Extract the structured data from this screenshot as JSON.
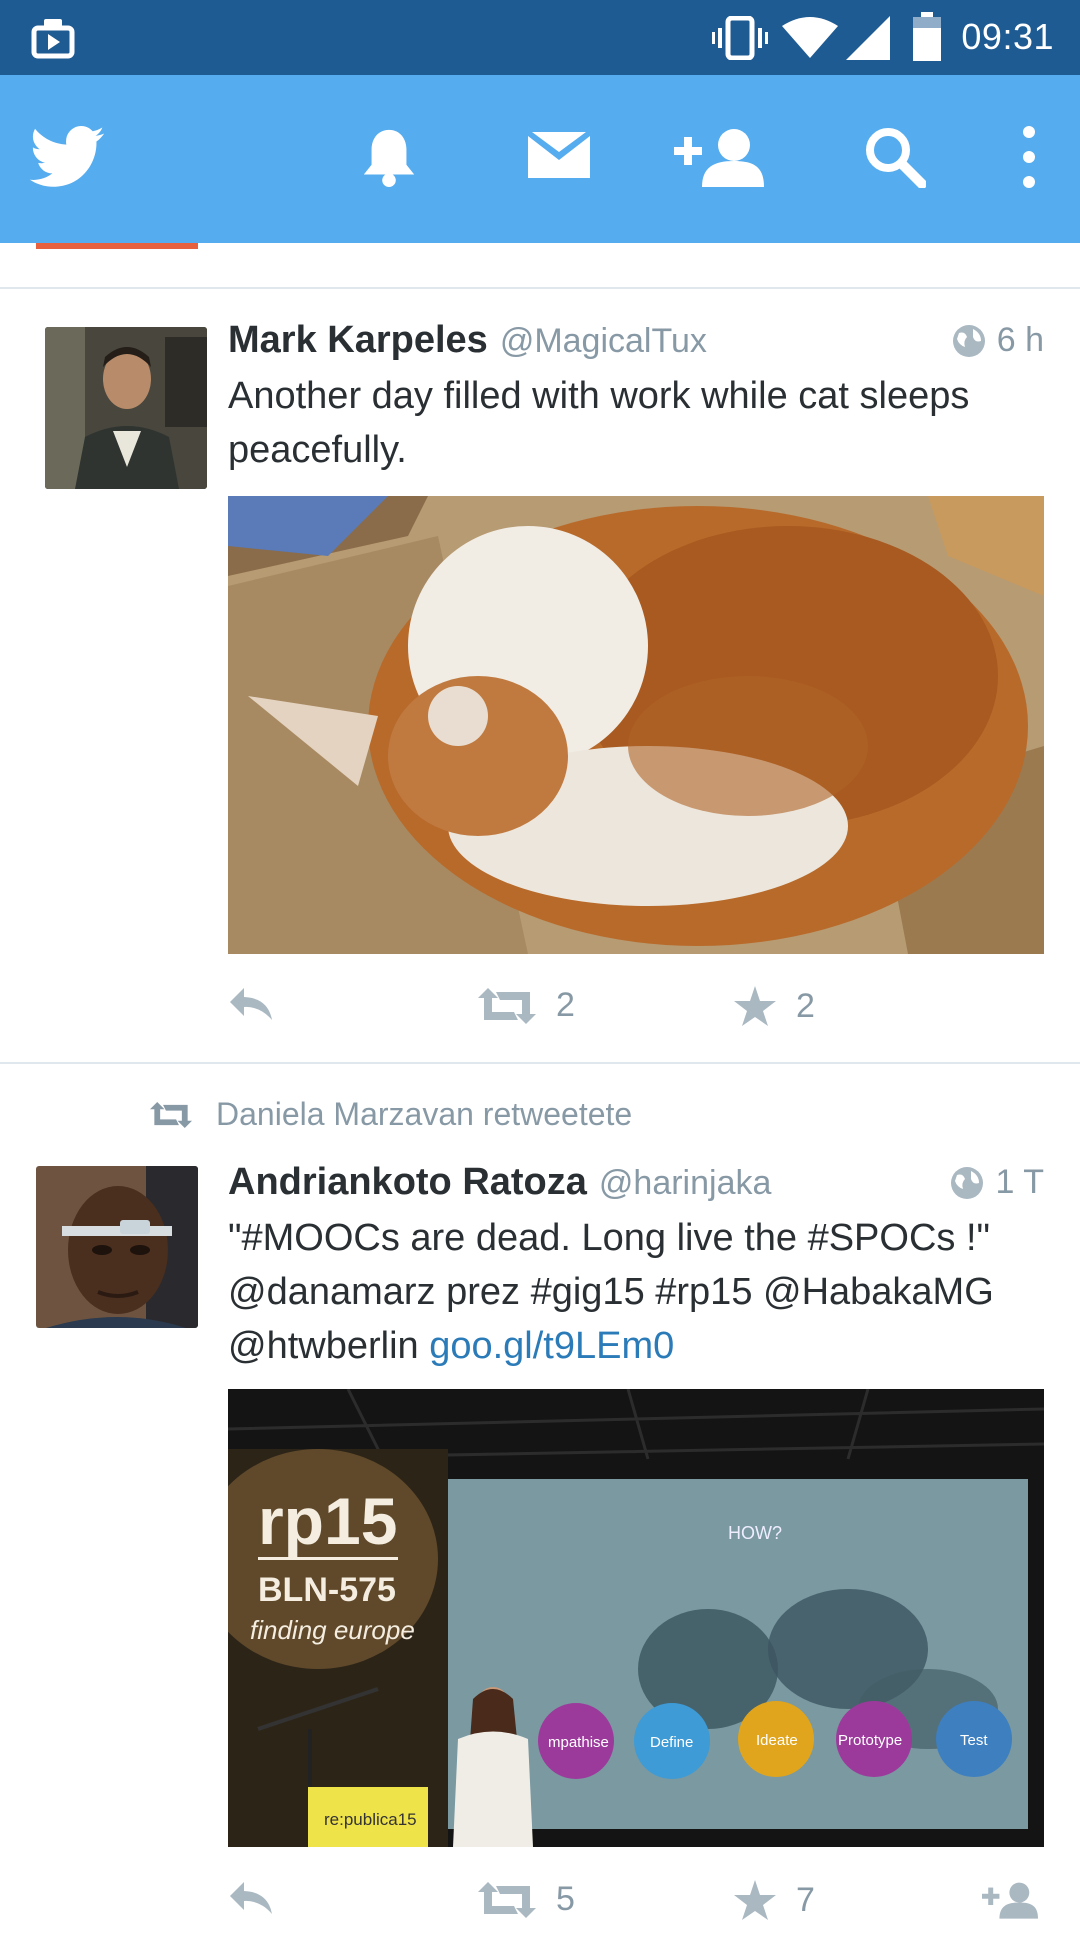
{
  "status_bar": {
    "time": "09:31"
  },
  "app_bar": {
    "icons": [
      "twitter-bird-icon",
      "bell-icon",
      "envelope-icon",
      "add-user-icon",
      "search-icon",
      "overflow-menu-icon"
    ]
  },
  "tweets": [
    {
      "name": "Mark Karpeles",
      "handle": "@MagicalTux",
      "time": "6 h",
      "text": "Another day filled with work while cat sleeps peacefully.",
      "media": "cat-photo",
      "retweets": "2",
      "favorites": "2"
    },
    {
      "retweeted_by": "Daniela Marzavan retweetete",
      "name": "Andriankoto Ratoza",
      "handle": "@harinjaka",
      "time": "1 T",
      "text": "\"#MOOCs are dead. Long live the #SPOCs !\" @danamarz prez #gig15 #rp15 @HabakaMG @htwberlin",
      "link": "goo.gl/t9LEm0",
      "media": "conference-photo",
      "media_text": {
        "logo": "rp15",
        "subtitle": "BLN-575",
        "tagline": "finding europe",
        "how": "HOW?",
        "steps": [
          "mpathise",
          "Define",
          "Ideate",
          "Prototype",
          "Test"
        ],
        "podium": "re:publica15"
      },
      "retweets": "5",
      "favorites": "7"
    }
  ],
  "colors": {
    "status_bar": "#1f5b93",
    "app_bar": "#55acee",
    "link": "#2b7bb9",
    "muted": "#8899a6"
  }
}
